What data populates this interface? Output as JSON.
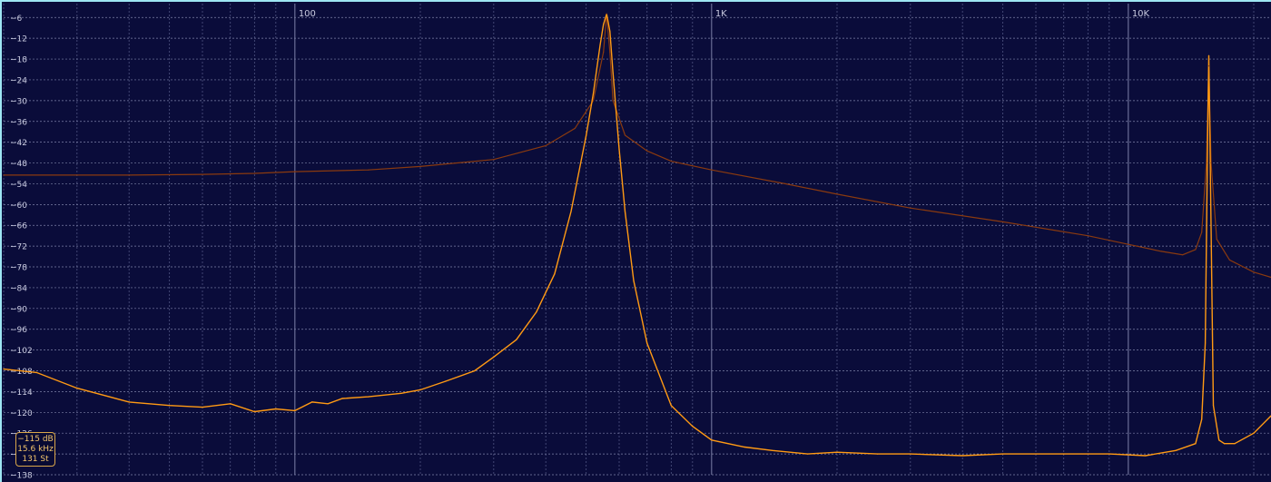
{
  "readout": {
    "level": "−115 dB",
    "frequency": "15.6 kHz",
    "note": "131 St"
  },
  "chart_data": {
    "type": "line",
    "x_scale": "log",
    "xlim": [
      20,
      22000
    ],
    "ylim": [
      -138,
      -2
    ],
    "x_ticks": [
      {
        "value": 100,
        "label": "100"
      },
      {
        "value": 1000,
        "label": "1K"
      },
      {
        "value": 10000,
        "label": "10K"
      }
    ],
    "y_ticks": [
      -6,
      -12,
      -18,
      -24,
      -30,
      -36,
      -42,
      -48,
      -54,
      -60,
      -66,
      -72,
      -78,
      -84,
      -90,
      -96,
      -102,
      -108,
      -114,
      -120,
      -126,
      -132,
      -138
    ],
    "grid": true,
    "colors": {
      "background": "#0a0c3a",
      "grid_major": "#7d81a8",
      "grid_minor": "#4f5482",
      "frame": "#9ee6f3",
      "spectrum": "#ff9a14",
      "envelope": "#8a3a0f",
      "tick_text": "#c9cbe0"
    },
    "series": [
      {
        "role": "spectrum",
        "x": [
          20,
          24,
          30,
          40,
          50,
          60,
          70,
          80,
          90,
          100,
          110,
          120,
          130,
          150,
          180,
          200,
          230,
          270,
          300,
          340,
          380,
          420,
          460,
          500,
          520,
          540,
          550,
          560,
          570,
          580,
          600,
          620,
          650,
          700,
          800,
          900,
          1000,
          1200,
          1400,
          1700,
          2000,
          2500,
          3000,
          4000,
          5000,
          7000,
          9000,
          11000,
          13000,
          14500,
          15000,
          15300,
          15500,
          15600,
          15700,
          16000,
          16500,
          17000,
          18000,
          20000,
          22000
        ],
        "y": [
          -107.5,
          -108.5,
          -113,
          -117,
          -118,
          -118.5,
          -117.5,
          -119.8,
          -119,
          -119.5,
          -117,
          -117.5,
          -116,
          -115.5,
          -114.5,
          -113.5,
          -111,
          -108,
          -104,
          -99,
          -91,
          -80,
          -62,
          -40,
          -28,
          -14,
          -8,
          -5,
          -10,
          -22,
          -44,
          -62,
          -82,
          -100,
          -118,
          -124,
          -128,
          -130,
          -131,
          -132,
          -131.5,
          -132,
          -132,
          -132.5,
          -132,
          -132,
          -132,
          -132.5,
          -131,
          -129,
          -122,
          -100,
          -40,
          -17,
          -40,
          -118,
          -128,
          -129,
          -129,
          -126,
          -121
        ]
      },
      {
        "role": "envelope",
        "x": [
          20,
          40,
          60,
          80,
          100,
          150,
          200,
          300,
          400,
          470,
          520,
          550,
          560,
          570,
          580,
          620,
          700,
          800,
          1000,
          1500,
          2000,
          3000,
          5000,
          8000,
          10000,
          12000,
          13500,
          14500,
          15000,
          15400,
          15600,
          15800,
          16300,
          17500,
          20000,
          22000
        ],
        "y": [
          -51.5,
          -51.5,
          -51.3,
          -51,
          -50.5,
          -50,
          -49,
          -47,
          -43,
          -38,
          -30,
          -16,
          -5,
          -16,
          -30,
          -40,
          -44.5,
          -47.5,
          -50,
          -54,
          -57,
          -61,
          -65,
          -69,
          -71.5,
          -73.5,
          -74.5,
          -73,
          -68,
          -48,
          -20,
          -48,
          -70,
          -76,
          -79.5,
          -81
        ]
      }
    ]
  }
}
